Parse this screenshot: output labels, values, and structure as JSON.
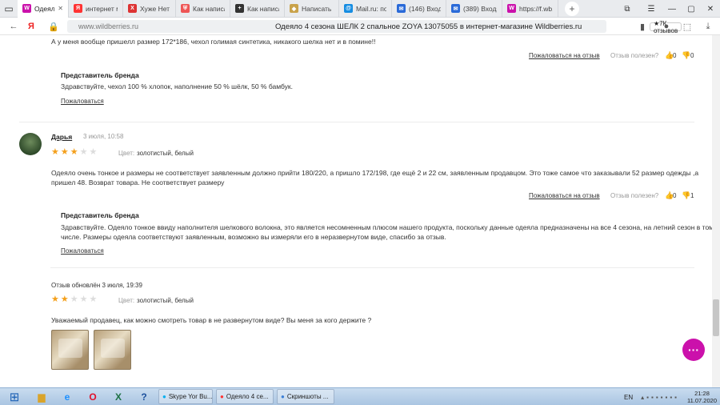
{
  "browser": {
    "tabs": [
      {
        "label": "Одеяло 4 с",
        "icon_color": "#cb11ab",
        "icon_glyph": "W",
        "active": true
      },
      {
        "label": "интернет ма",
        "icon_color": "#f33",
        "icon_glyph": "Я",
        "active": false
      },
      {
        "label": "Хуже Нет - К",
        "icon_color": "#d33",
        "icon_glyph": "Х",
        "active": false
      },
      {
        "label": "Как написать",
        "icon_color": "#e55",
        "icon_glyph": "⛨",
        "active": false
      },
      {
        "label": "Как написать",
        "icon_color": "#333",
        "icon_glyph": "+",
        "active": false
      },
      {
        "label": "Написать и о",
        "icon_color": "#c9a24a",
        "icon_glyph": "◆",
        "active": false
      },
      {
        "label": "Mail.ru: почт",
        "icon_color": "#168de2",
        "icon_glyph": "@",
        "active": false
      },
      {
        "label": "(146) Входящ",
        "icon_color": "#2a6ad8",
        "icon_glyph": "✉",
        "active": false
      },
      {
        "label": "(389) Входящ",
        "icon_color": "#2a6ad8",
        "icon_glyph": "✉",
        "active": false
      },
      {
        "label": "https://f.wb.",
        "icon_color": "#cb11ab",
        "icon_glyph": "W",
        "active": false
      }
    ],
    "url": "www.wildberries.ru",
    "page_title": "Одеяло 4 сезона ШЕЛК 2 спальное ZOYA 13075055 в интернет-магазине Wildberries.ru",
    "reviews_badge": "★7К отзывов"
  },
  "page": {
    "top_review_text": "А у меня вообще пришелл размер 172*186, чехол голимая синтетика, никакого шелка нет и в помине!!",
    "complain_review_label": "Пожаловаться на отзыв",
    "helpful_label": "Отзыв полезен?",
    "reply_title": "Представитель бренда",
    "complain_label": "Пожаловаться",
    "review1": {
      "likes": "0",
      "dislikes": "0"
    },
    "reply1": "Здравствуйте, чехол 100 % хлопок, наполнение 50 % шёлк, 50 % бамбук.",
    "review2": {
      "author": "Дарья",
      "date": "3 июля, 10:58",
      "rating": 3,
      "color_label": "Цвет:",
      "color_value": "золотистый, белый",
      "text_line1": "Одеяло очень тонкое и размеры не соответствует заявленным должно прийти 180/220, а пришло 172/198, где ещё 2 и 22 см, заявленным продавцом. Это тоже самое что заказывали 52 размер одежды ,а",
      "text_line2": "пришел 48. Возврат товара. Не соответствует размеру",
      "likes": "0",
      "dislikes": "1"
    },
    "reply2_line1": "Здравствуйте. Одеяло тонкое ввиду наполнителя шелкового волокна, это является несомненным плюсом нашего продукта, поскольку данные одеяла предназначены на все 4 сезона, на летний сезон в том",
    "reply2_line2": "числе. Размеры одеяла соответствуют заявленным, возможно вы измеряли его в неразвернутом виде, спасибо за отзыв.",
    "review3": {
      "updated": "Отзыв обновлён 3 июля, 19:39",
      "rating": 2,
      "color_label": "Цвет:",
      "color_value": "золотистый, белый",
      "text": "Уважаемый продавец, как можно смотреть товар в не развернутом виде? Вы меня за кого держите ?"
    }
  },
  "taskbar": {
    "apps": [
      {
        "label": "Skype Yor Bu...",
        "color": "#00aff0"
      },
      {
        "label": "Одеяло 4 се...",
        "color": "#f33"
      },
      {
        "label": "Скриншоты ...",
        "color": "#3c7fd6"
      }
    ],
    "lang": "EN",
    "time": "21:28",
    "date": "11.07.2020"
  },
  "colors": {
    "star_on": "#f4a01c",
    "star_off": "#dcdcdc",
    "brand": "#cb11ab"
  }
}
